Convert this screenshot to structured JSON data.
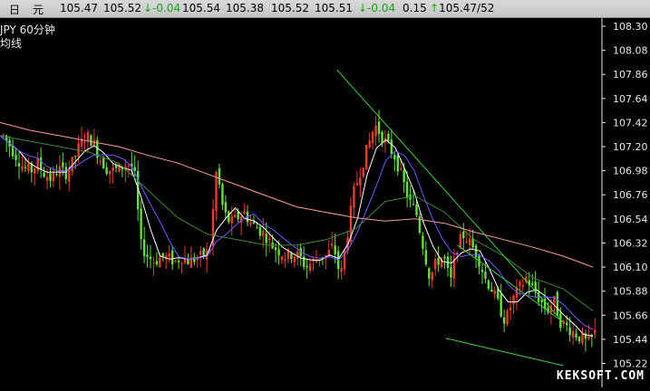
{
  "header": {
    "label_day": "日",
    "label_yuan": "元",
    "v1": "105.47",
    "v2": "105.52",
    "change": "-0.04",
    "v3": "105.54",
    "v4": "105.38",
    "v5": "105.52",
    "v6": "105.51",
    "change2": "-0.04",
    "v7": "0.15",
    "ratio": "105.47/52"
  },
  "caption": {
    "symbol_period": "JPY   60分钟",
    "line2": "均线"
  },
  "watermark": "KEKSOFT.COM",
  "colors": {
    "up": "#e83c2c",
    "down": "#64e03c",
    "ma_short": "#ffffff",
    "ma_mid": "#6a5cff",
    "ma_long": "#3a8a3a",
    "ma_longest": "#ff9a9a",
    "trendline": "#3ad23a",
    "axis": "#e8e8e8"
  },
  "chart_data": {
    "type": "candlestick",
    "title": "",
    "ylim": [
      105.1,
      108.3
    ],
    "y_ticks": [
      "108.30",
      "108.08",
      "107.86",
      "107.64",
      "107.42",
      "107.20",
      "106.98",
      "106.76",
      "106.54",
      "106.32",
      "106.10",
      "105.88",
      "105.66",
      "105.44",
      "105.22"
    ],
    "grid": false,
    "series": [
      {
        "kind": "price_path",
        "values": [
          107.3,
          107.2,
          107.1,
          107.0,
          106.98,
          107.05,
          106.95,
          106.9,
          107.0,
          106.95,
          107.05,
          107.2,
          107.3,
          107.25,
          107.1,
          107.0,
          106.98,
          107.0,
          107.05,
          107.0,
          106.3,
          106.2,
          106.15,
          106.2,
          106.18,
          106.15,
          106.2,
          106.15,
          106.18,
          106.2,
          106.25,
          107.0,
          106.6,
          106.5,
          106.55,
          106.6,
          106.5,
          106.45,
          106.4,
          106.3,
          106.25,
          106.2,
          106.22,
          106.2,
          106.1,
          106.15,
          106.2,
          106.2,
          106.3,
          106.0,
          106.4,
          106.8,
          107.0,
          107.2,
          107.4,
          107.3,
          107.2,
          107.1,
          106.9,
          106.7,
          106.6,
          106.3,
          106.0,
          106.15,
          106.2,
          105.95,
          106.3,
          106.4,
          106.3,
          106.2,
          106.0,
          105.9,
          105.75,
          105.6,
          105.8,
          105.9,
          106.0,
          105.9,
          105.8,
          105.7,
          105.8,
          105.6,
          105.55,
          105.5,
          105.45,
          105.4,
          105.5
        ]
      },
      {
        "kind": "ma_longest",
        "values": [
          107.42,
          107.35,
          107.3,
          107.25,
          107.2,
          107.12,
          107.05,
          106.95,
          106.85,
          106.75,
          106.65,
          106.6,
          106.55,
          106.52,
          106.54,
          106.5,
          106.42,
          106.35,
          106.28,
          106.2,
          106.1
        ]
      },
      {
        "kind": "ma_long",
        "values": [
          107.3,
          107.25,
          107.2,
          107.15,
          107.05,
          106.8,
          106.55,
          106.4,
          106.35,
          106.3,
          106.3,
          106.35,
          106.45,
          106.7,
          106.75,
          106.6,
          106.35,
          106.2,
          106.0,
          105.9,
          105.7
        ]
      }
    ],
    "trendlines": [
      {
        "from": [
          0.56,
          107.9
        ],
        "to": [
          0.92,
          105.6
        ]
      },
      {
        "from": [
          0.74,
          105.45
        ],
        "to": [
          0.92,
          105.2
        ]
      },
      {
        "from": [
          0.76,
          106.3
        ],
        "to": [
          0.92,
          105.6
        ]
      }
    ]
  }
}
